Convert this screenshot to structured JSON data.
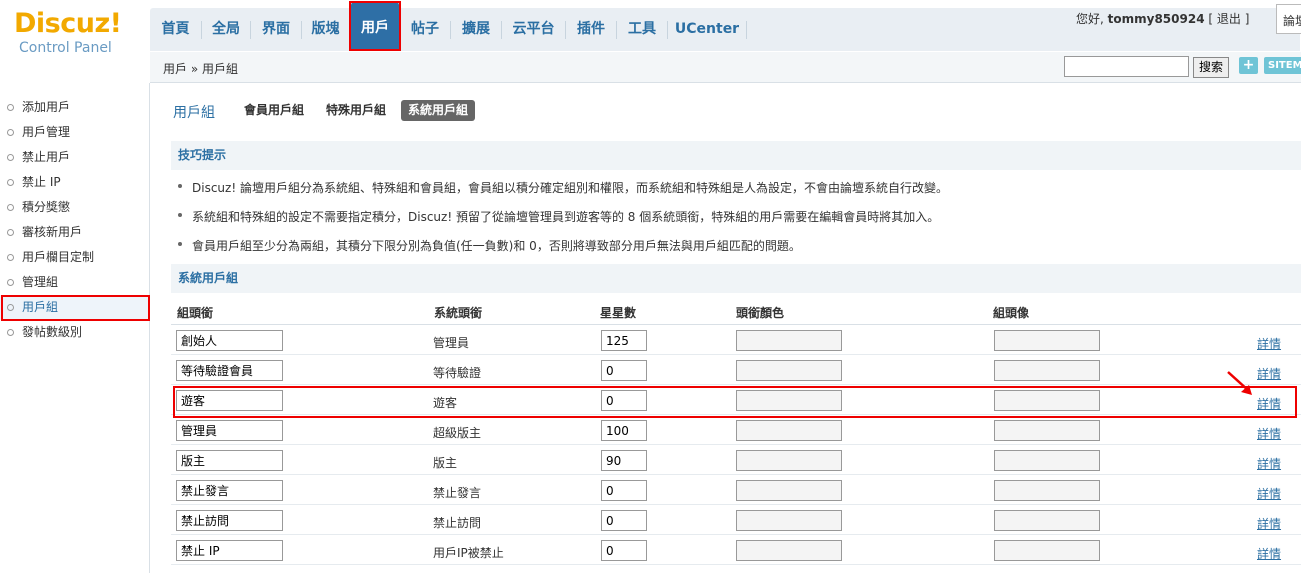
{
  "logo": {
    "line1": "Discuz!",
    "line2": "Control Panel"
  },
  "nav": {
    "items": [
      "首頁",
      "全局",
      "界面",
      "版塊",
      "用戶",
      "帖子",
      "擴展",
      "云平台",
      "插件",
      "工具",
      "UCenter"
    ],
    "active_index": 4
  },
  "user": {
    "greeting": "您好, ",
    "username": "tommy850924",
    "logout": "[ 退出 ]",
    "site_select": "論壇"
  },
  "subbar": {
    "breadcrumb": "用戶 » 用戶組",
    "search_placeholder": "",
    "search_button": "搜索",
    "add_button": "+",
    "sitemap_button": "SITEMAP"
  },
  "sidebar": {
    "items": [
      "添加用戶",
      "用戶管理",
      "禁止用戶",
      "禁止 IP",
      "積分獎懲",
      "審核新用戶",
      "用戶欄目定制",
      "管理組",
      "用戶組",
      "發帖數級別"
    ],
    "active_index": 8
  },
  "main": {
    "title": "用戶組",
    "tabs": [
      "會員用戶組",
      "特殊用戶組",
      "系統用戶組"
    ],
    "active_tab_index": 2,
    "tips_heading": "技巧提示",
    "tips": [
      "Discuz! 論壇用戶組分為系統組、特殊組和會員組，會員組以積分確定組別和權限，而系統組和特殊組是人為設定，不會由論壇系統自行改變。",
      "系統組和特殊組的設定不需要指定積分，Discuz! 預留了從論壇管理員到遊客等的 8 個系統頭銜，特殊組的用戶需要在編輯會員時將其加入。",
      "會員用戶組至少分為兩組，其積分下限分別為負值(任一負數)和 0，否則將導致部分用戶無法與用戶組匹配的問題。"
    ],
    "section_heading": "系統用戶組",
    "columns": [
      "組頭銜",
      "系統頭銜",
      "星星數",
      "頭銜顏色",
      "組頭像"
    ],
    "detail_label": "詳情",
    "rows": [
      {
        "name": "創始人",
        "system_title": "管理員",
        "stars": "125",
        "color": "",
        "avatar": ""
      },
      {
        "name": "等待驗證會員",
        "system_title": "等待驗證",
        "stars": "0",
        "color": "",
        "avatar": ""
      },
      {
        "name": "遊客",
        "system_title": "遊客",
        "stars": "0",
        "color": "",
        "avatar": ""
      },
      {
        "name": "管理員",
        "system_title": "超級版主",
        "stars": "100",
        "color": "",
        "avatar": ""
      },
      {
        "name": "版主",
        "system_title": "版主",
        "stars": "90",
        "color": "",
        "avatar": ""
      },
      {
        "name": "禁止發言",
        "system_title": "禁止發言",
        "stars": "0",
        "color": "",
        "avatar": ""
      },
      {
        "name": "禁止訪問",
        "system_title": "禁止訪問",
        "stars": "0",
        "color": "",
        "avatar": ""
      },
      {
        "name": "禁止 IP",
        "system_title": "用戶IP被禁止",
        "stars": "0",
        "color": "",
        "avatar": ""
      }
    ]
  },
  "colors": {
    "accent": "#2b6fa3",
    "nav_active": "#2e6fa6",
    "logo": "#f2a900",
    "highlight": "#e00000"
  }
}
